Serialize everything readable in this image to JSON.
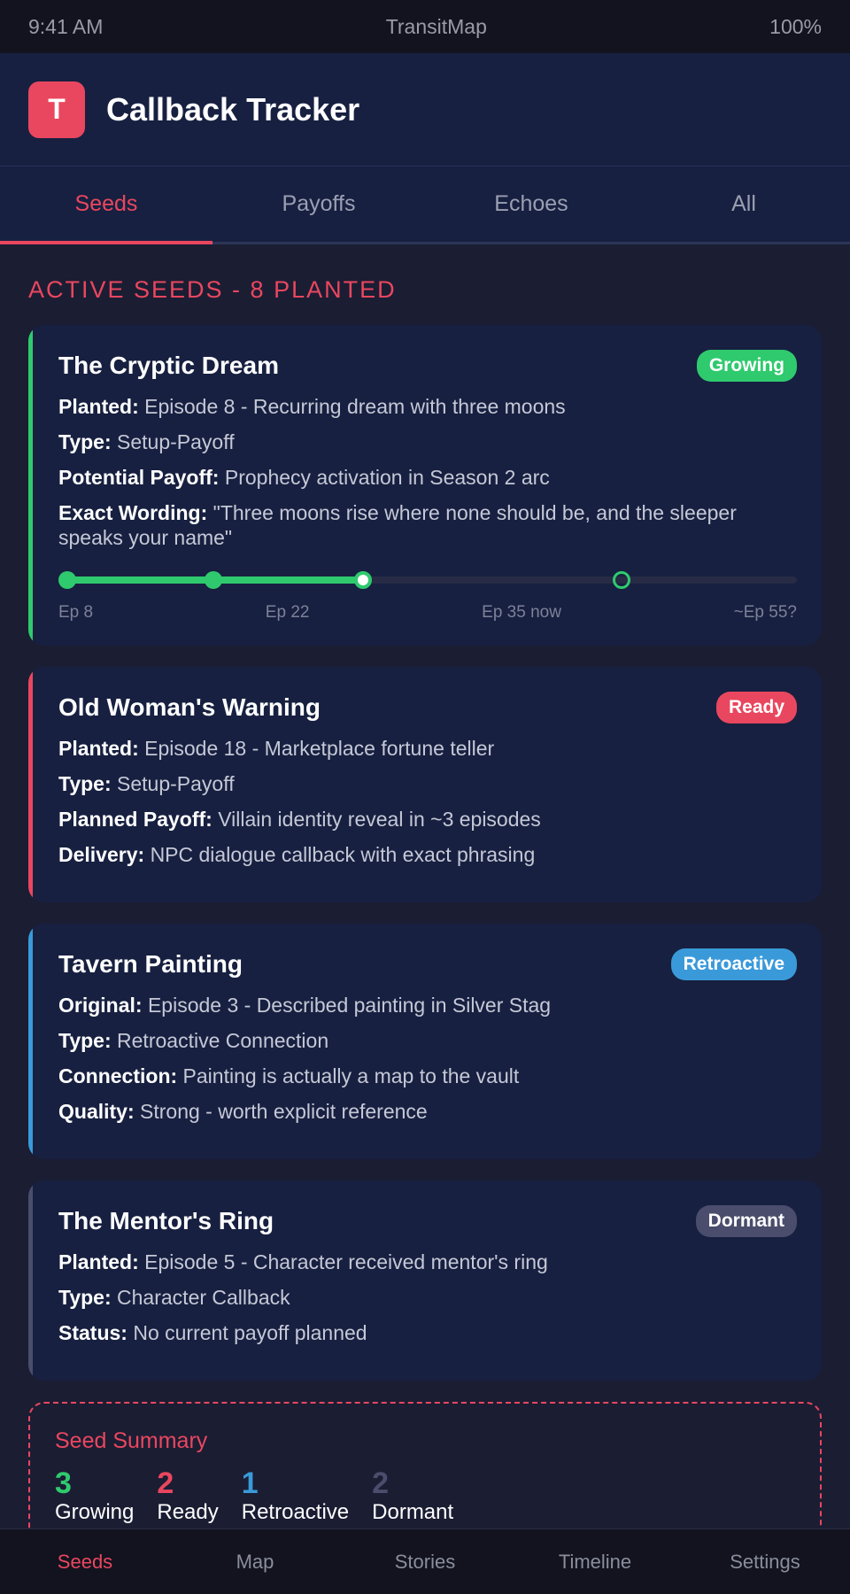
{
  "status_bar": {
    "time": "9:41 AM",
    "app_name": "TransitMap",
    "battery": "100%"
  },
  "header": {
    "logo_letter": "T",
    "title": "Callback Tracker"
  },
  "tabs": [
    {
      "label": "Seeds",
      "active": true
    },
    {
      "label": "Payoffs",
      "active": false
    },
    {
      "label": "Echoes",
      "active": false
    },
    {
      "label": "All",
      "active": false
    }
  ],
  "section_title": "ACTIVE SEEDS - 8 PLANTED",
  "colors": {
    "growing": "#2fca6e",
    "ready": "#e9475f",
    "retroactive": "#3a9ad9",
    "dormant": "#4a4d6b"
  },
  "cards": [
    {
      "title": "The Cryptic Dream",
      "badge": "Growing",
      "fields": [
        {
          "label": "Planted:",
          "value": "Episode 8 - Recurring dream with three moons"
        },
        {
          "label": "Type:",
          "value": "Setup-Payoff"
        },
        {
          "label": "Potential Payoff:",
          "value": "Prophecy activation in Season 2 arc"
        },
        {
          "label": "Exact Wording:",
          "value": "\"Three moons rise where none should be, and the sleeper speaks your name\""
        }
      ],
      "timeline": {
        "progress": 0.41,
        "labels": [
          "Ep 8",
          "Ep 22",
          "Ep 35 now",
          "~Ep 55?"
        ]
      }
    },
    {
      "title": "Old Woman's Warning",
      "badge": "Ready",
      "fields": [
        {
          "label": "Planted:",
          "value": "Episode 18 - Marketplace fortune teller"
        },
        {
          "label": "Type:",
          "value": "Setup-Payoff"
        },
        {
          "label": "Planned Payoff:",
          "value": "Villain identity reveal in ~3 episodes"
        },
        {
          "label": "Delivery:",
          "value": "NPC dialogue callback with exact phrasing"
        }
      ]
    },
    {
      "title": "Tavern Painting",
      "badge": "Retroactive",
      "fields": [
        {
          "label": "Original:",
          "value": "Episode 3 - Described painting in Silver Stag"
        },
        {
          "label": "Type:",
          "value": "Retroactive Connection"
        },
        {
          "label": "Connection:",
          "value": "Painting is actually a map to the vault"
        },
        {
          "label": "Quality:",
          "value": "Strong - worth explicit reference"
        }
      ]
    },
    {
      "title": "The Mentor's Ring",
      "badge": "Dormant",
      "fields": [
        {
          "label": "Planted:",
          "value": "Episode 5 - Character received mentor's ring"
        },
        {
          "label": "Type:",
          "value": "Character Callback"
        },
        {
          "label": "Status:",
          "value": "No current payoff planned"
        }
      ]
    }
  ],
  "summary": {
    "title": "Seed Summary",
    "stats": [
      {
        "value": "3",
        "label": "Growing"
      },
      {
        "value": "2",
        "label": "Ready"
      },
      {
        "value": "1",
        "label": "Retroactive"
      },
      {
        "value": "2",
        "label": "Dormant"
      }
    ]
  },
  "bottom_nav": [
    {
      "label": "Seeds",
      "active": true
    },
    {
      "label": "Map",
      "active": false
    },
    {
      "label": "Stories",
      "active": false
    },
    {
      "label": "Timeline",
      "active": false
    },
    {
      "label": "Settings",
      "active": false
    }
  ]
}
